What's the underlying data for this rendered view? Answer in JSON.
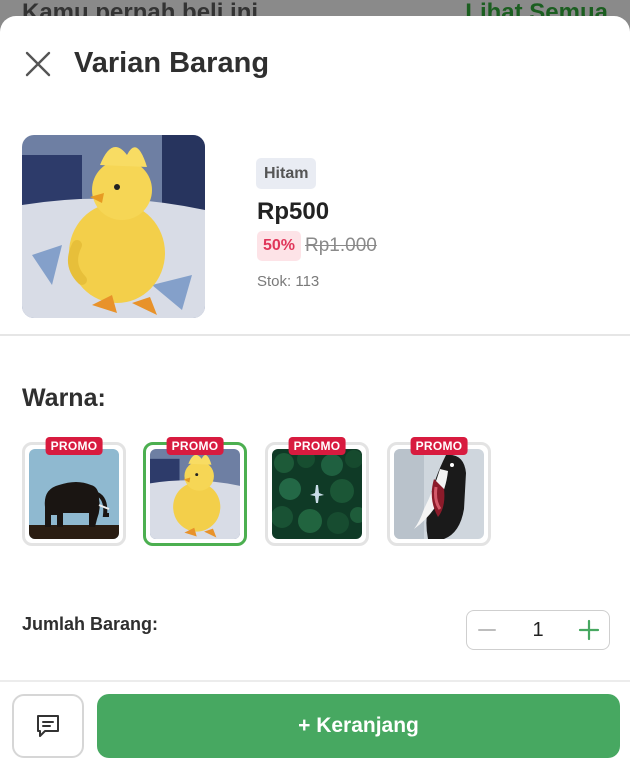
{
  "backdrop": {
    "left_text": "Kamu pernah beli ini",
    "right_text": "Lihat Semua"
  },
  "header": {
    "title": "Varian Barang"
  },
  "product": {
    "variant": "Hitam",
    "price": "Rp500",
    "discount": "50%",
    "old_price": "Rp1.000",
    "stock": "Stok: 113"
  },
  "variants": {
    "label": "Warna:",
    "items": [
      {
        "promo": "PROMO",
        "image": "elephant-silhouette",
        "selected": false
      },
      {
        "promo": "PROMO",
        "image": "duckling",
        "selected": true
      },
      {
        "promo": "PROMO",
        "image": "forest-aerial",
        "selected": false
      },
      {
        "promo": "PROMO",
        "image": "penguin",
        "selected": false
      }
    ]
  },
  "quantity": {
    "label": "Jumlah Barang:",
    "value": "1"
  },
  "footer": {
    "cart_label": "+ Keranjang",
    "chat_icon": "chat-icon"
  },
  "colors": {
    "accent": "#47a861",
    "promo": "#d81b3f",
    "discount": "#e0365a"
  }
}
